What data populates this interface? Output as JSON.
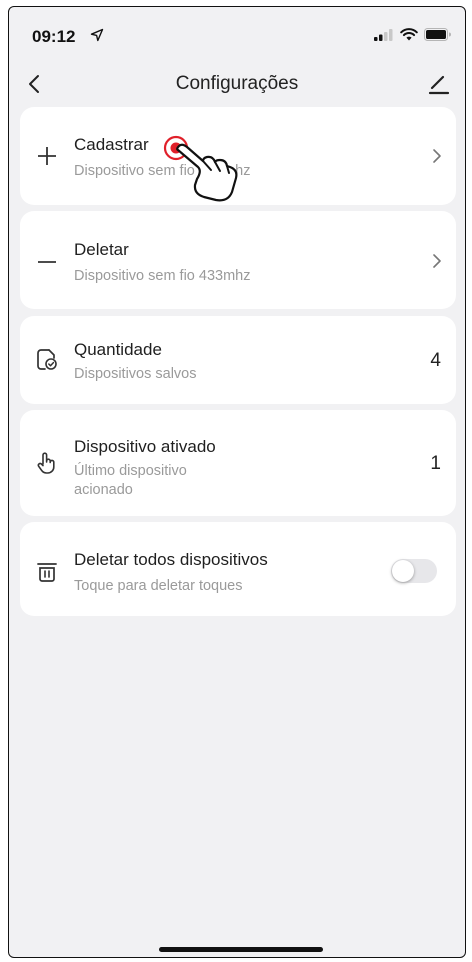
{
  "status_bar": {
    "time": "09:12",
    "icons": [
      "location-arrow-icon",
      "cellular-signal-icon",
      "wifi-icon",
      "battery-icon"
    ]
  },
  "nav": {
    "title": "Configurações",
    "back_icon": "chevron-left-icon",
    "edit_icon": "edit-pencil-icon"
  },
  "settings": [
    {
      "label": "Cadastrar",
      "sub": "Dispositivo sem fio 433mhz",
      "icon": "plus-icon",
      "trailing": "chevron-right-icon"
    },
    {
      "label": "Deletar",
      "sub": "Dispositivo sem fio 433mhz",
      "icon": "minus-icon",
      "trailing": "chevron-right-icon"
    },
    {
      "label": "Quantidade",
      "sub": "Dispositivos salvos",
      "icon": "saved-devices-icon",
      "value": "4"
    },
    {
      "label": "Dispositivo ativado",
      "sub_line1": "Último dispositivo",
      "sub_line2": "acionado",
      "icon": "tap-hand-icon",
      "value": "1"
    },
    {
      "label": "Deletar todos dispositivos",
      "sub": "Toque para deletar toques",
      "icon": "trash-icon",
      "toggle_on": false
    }
  ],
  "colors": {
    "background": "#f1f1f3",
    "card": "#ffffff",
    "subtext": "#9a9a9a",
    "tap_indicator": "#e0202a"
  }
}
